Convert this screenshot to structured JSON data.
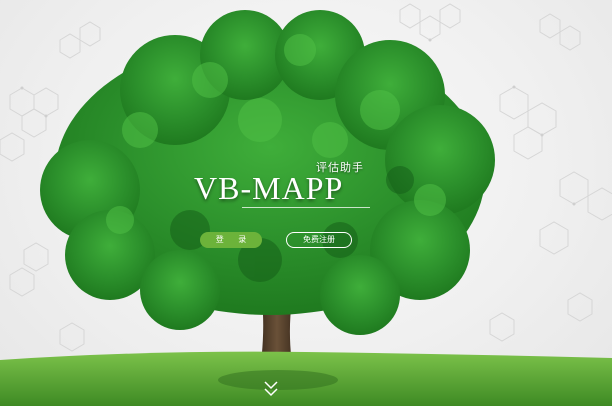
{
  "hero": {
    "subtitle": "评估助手",
    "title": "VB-MAPP",
    "login_label": "登 录",
    "register_label": "免费注册"
  },
  "icons": {
    "scroll_down": "double-chevron-down-icon"
  },
  "colors": {
    "accent": "#6cb33a",
    "background": "#f0f0f0",
    "foliage_dark": "#1f7a1f",
    "foliage_light": "#3fae3a",
    "grass": "#4a9a2a"
  }
}
